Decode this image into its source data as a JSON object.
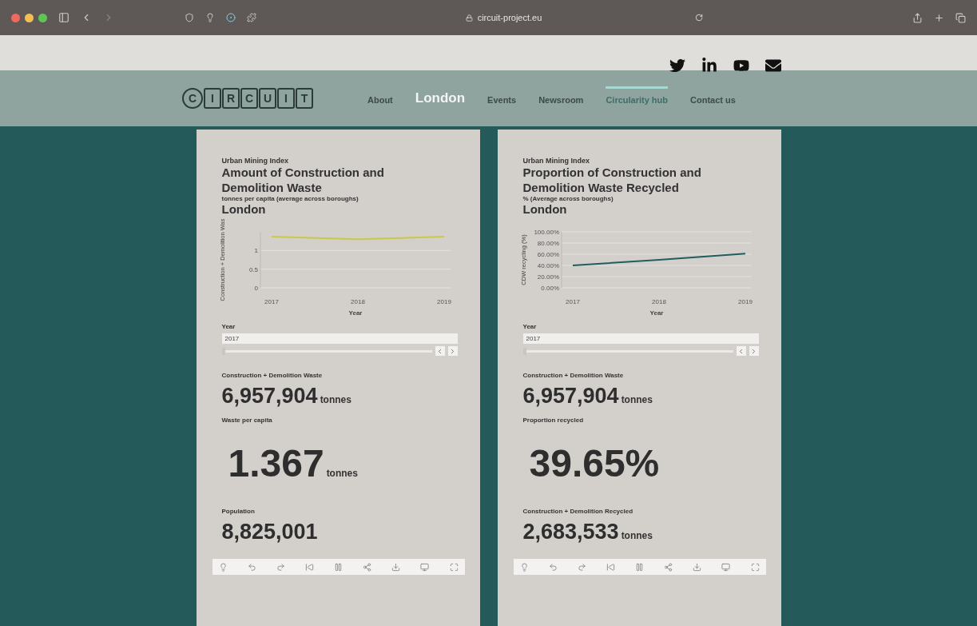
{
  "browser": {
    "url": "circuit-project.eu"
  },
  "site": {
    "logo_letters": [
      "C",
      "I",
      "R",
      "C",
      "U",
      "I",
      "T"
    ],
    "nav": [
      {
        "label": "About",
        "kind": "link",
        "selected": false
      },
      {
        "label": "London",
        "kind": "title"
      },
      {
        "label": "Events",
        "kind": "link",
        "selected": false
      },
      {
        "label": "Newsroom",
        "kind": "link",
        "selected": false
      },
      {
        "label": "Circularity hub",
        "kind": "link",
        "selected": true
      },
      {
        "label": "Contact us",
        "kind": "link",
        "selected": false
      }
    ]
  },
  "cards": [
    {
      "eyebrow": "Urban Mining Index",
      "title": "Amount of Construction and Demolition Waste",
      "subtitle": "tonnes per capita (average across boroughs)",
      "place": "London",
      "chart_data": {
        "type": "line",
        "xlabel": "Year",
        "ylabel": "Construction + Demolition Was",
        "categories": [
          "2017",
          "2018",
          "2019"
        ],
        "series": [
          {
            "color": "#c8c84a",
            "values": [
              1.37,
              1.3,
              1.37
            ]
          }
        ],
        "yticks": [
          0,
          0.5,
          1
        ],
        "ylim": [
          0,
          1.5
        ],
        "grid": true
      },
      "slider": {
        "label": "Year",
        "value": "2017",
        "level": 0
      },
      "stats": [
        {
          "label": "Construction + Demolition Waste",
          "value": "6,957,904",
          "unit": "tonnes",
          "kind": "medium"
        },
        {
          "label": "Waste per capita",
          "value": "1.367",
          "unit": "tonnes",
          "kind": "large"
        },
        {
          "label": "Population",
          "value": "8,825,001",
          "kind": "medium"
        }
      ]
    },
    {
      "eyebrow": "Urban Mining Index",
      "title": "Proportion of Construction and Demolition Waste Recycled",
      "subtitle": "% (Average across boroughs)",
      "place": "London",
      "chart_data": {
        "type": "line",
        "xlabel": "Year",
        "ylabel": "CDW recycling (%)",
        "categories": [
          "2017",
          "2018",
          "2019"
        ],
        "series": [
          {
            "color": "#1f5e5a",
            "values": [
              40,
              50,
              61
            ]
          }
        ],
        "grid": true,
        "ylim": [
          0,
          100
        ],
        "yticks": [
          {
            "value": 0,
            "label": "0.00%"
          },
          {
            "value": 20,
            "label": "20.00%"
          },
          {
            "value": 40,
            "label": "40.00%"
          },
          {
            "value": 60,
            "label": "60.00%"
          },
          {
            "value": 80,
            "label": "80.00%"
          },
          {
            "value": 100,
            "label": "100.00%"
          }
        ]
      },
      "slider": {
        "label": "Year",
        "value": "2017",
        "level": 0
      },
      "stats": [
        {
          "label": "Construction + Demolition Waste",
          "value": "6,957,904",
          "unit": "tonnes",
          "kind": "medium"
        },
        {
          "label": "Proportion recycled",
          "value": "39.65%",
          "kind": "large"
        },
        {
          "label": "Construction + Demolition Recycled",
          "value": "2,683,533",
          "unit": "tonnes",
          "kind": "medium"
        }
      ]
    }
  ]
}
